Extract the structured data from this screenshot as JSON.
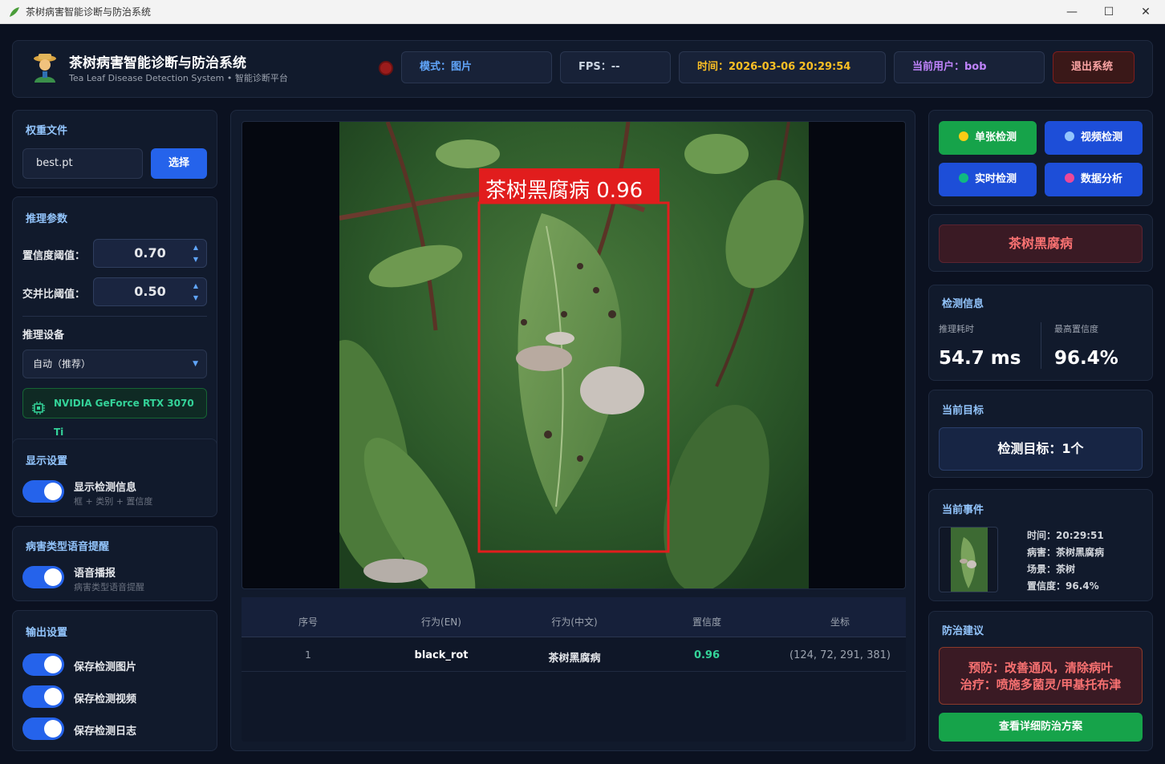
{
  "window": {
    "title": "茶树病害智能诊断与防治系统",
    "minimize": "—",
    "maximize": "☐",
    "close": "✕"
  },
  "header": {
    "title": "茶树病害智能诊断与防治系统",
    "subtitle": "Tea Leaf Disease Detection System • 智能诊断平台",
    "mode": "模式：图片",
    "fps": "FPS：--",
    "time": "时间：2026-03-06 20:29:54",
    "user": "当前用户：bob",
    "logout": "退出系统",
    "status_color": "#9b1c1c"
  },
  "weights": {
    "title": "权重文件",
    "file": "best.pt",
    "select": "选择"
  },
  "inference": {
    "title": "推理参数",
    "conf_label": "置信度阈值：",
    "conf_value": "0.70",
    "iou_label": "交并比阈值：",
    "iou_value": "0.50",
    "device_title": "推理设备",
    "device_value": "自动（推荐）",
    "gpu": "NVIDIA GeForce RTX 3070 Ti"
  },
  "display": {
    "title": "显示设置",
    "toggle_label": "显示检测信息",
    "toggle_sub": "框 + 类别 + 置信度",
    "on": true
  },
  "voice": {
    "title": "病害类型语音提醒",
    "toggle_label": "语音播报",
    "toggle_sub": "病害类型语音提醒",
    "on": true
  },
  "output": {
    "title": "输出设置",
    "items": [
      "保存检测图片",
      "保存检测视频",
      "保存检测日志"
    ]
  },
  "detection": {
    "box_label": "茶树黑腐病 0.96"
  },
  "table": {
    "headers": [
      "序号",
      "行为(EN)",
      "行为(中文)",
      "置信度",
      "坐标"
    ],
    "rows": [
      [
        "1",
        "black_rot",
        "茶树黑腐病",
        "0.96",
        "(124, 72, 291, 381)"
      ]
    ]
  },
  "modes": {
    "single": "单张检测",
    "video": "视频检测",
    "realtime": "实时检测",
    "analysis": "数据分析"
  },
  "result": {
    "disease": "茶树黑腐病"
  },
  "info": {
    "title": "检测信息",
    "time_label": "推理耗时",
    "time_value": "54.7 ms",
    "conf_label": "最高置信度",
    "conf_value": "96.4%"
  },
  "target": {
    "title": "当前目标",
    "value": "检测目标：1个"
  },
  "event": {
    "title": "当前事件",
    "time": "时间：20:29:51",
    "disease": "病害：茶树黑腐病",
    "scene": "场景：茶树",
    "conf": "置信度：96.4%"
  },
  "advice": {
    "title": "防治建议",
    "prevent": "预防：改善通风，清除病叶",
    "treat": "治疗：喷施多菌灵/甲基托布津",
    "details": "查看详细防治方案"
  }
}
